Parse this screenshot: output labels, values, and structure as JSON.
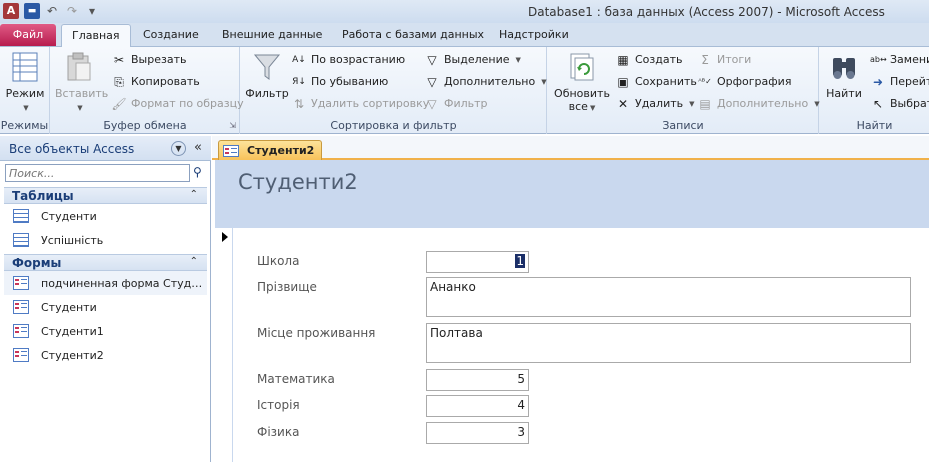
{
  "window": {
    "title": "Database1 : база данных (Access 2007)  -  Microsoft Access",
    "app_icon_letter": "A"
  },
  "ribbon_tabs": {
    "file": "Файл",
    "home": "Главная",
    "create": "Создание",
    "external": "Внешние данные",
    "db_tools": "Работа с базами данных",
    "addins": "Надстройки"
  },
  "ribbon": {
    "views": {
      "label": "Режимы",
      "mode": "Режим"
    },
    "clipboard": {
      "label": "Буфер обмена",
      "paste": "Вставить",
      "cut": "Вырезать",
      "copy": "Копировать",
      "format_painter": "Формат по образцу"
    },
    "sort_filter": {
      "label": "Сортировка и фильтр",
      "filter": "Фильтр",
      "ascending": "По возрастанию",
      "descending": "По убыванию",
      "remove_sort": "Удалить сортировку",
      "selection": "Выделение",
      "advanced": "Дополнительно",
      "toggle_filter": "Фильтр"
    },
    "records": {
      "label": "Записи",
      "refresh_line1": "Обновить",
      "refresh_line2": "все",
      "new": "Создать",
      "save": "Сохранить",
      "delete": "Удалить",
      "totals": "Итоги",
      "spelling": "Орфография",
      "more": "Дополнительно"
    },
    "find": {
      "label": "Найти",
      "find": "Найти",
      "replace": "Заменить",
      "goto": "Перейти",
      "select": "Выбрать"
    }
  },
  "nav": {
    "title": "Все объекты Access",
    "search_placeholder": "Поиск...",
    "tables_header": "Таблицы",
    "tables": [
      "Студенти",
      "Успішність"
    ],
    "forms_header": "Формы",
    "forms": [
      "подчиненная форма Студенти",
      "Студенти",
      "Студенти1",
      "Студенти2"
    ]
  },
  "document": {
    "tab_label": "Студенти2",
    "form_title": "Студенти2"
  },
  "form_fields": {
    "school_label": "Школа",
    "school_value": "1",
    "surname_label": "Прізвище",
    "surname_value": "Ананко",
    "residence_label": "Місце проживання",
    "residence_value": "Полтава",
    "math_label": "Математика",
    "math_value": "5",
    "history_label": "Історія",
    "history_value": "4",
    "physics_label": "Фізика",
    "physics_value": "3"
  }
}
